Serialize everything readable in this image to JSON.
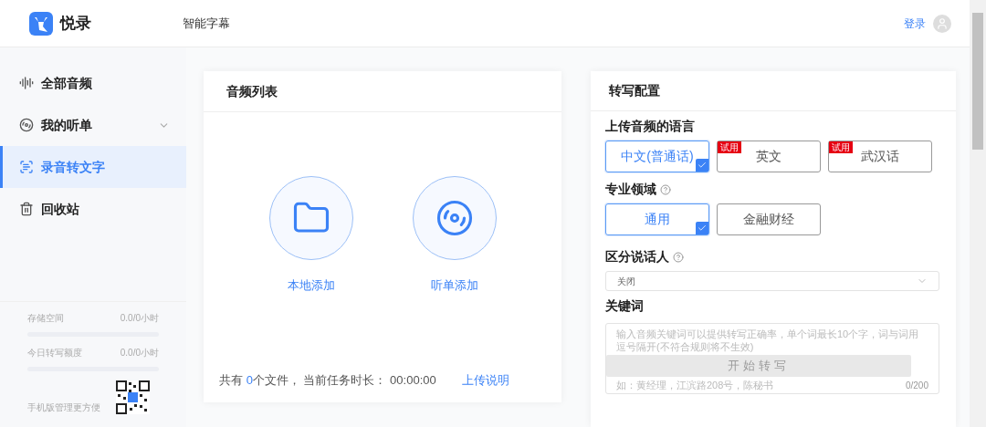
{
  "header": {
    "brand": "悦录",
    "nav_link": "智能字幕",
    "login": "登录"
  },
  "sidebar": {
    "items": [
      {
        "label": "全部音频",
        "selected": false
      },
      {
        "label": "我的听单",
        "selected": false,
        "expanded": false
      },
      {
        "label": "录音转文字",
        "selected": true
      },
      {
        "label": "回收站",
        "selected": false
      }
    ],
    "quotas": [
      {
        "label": "存储空间",
        "reading": "0.0/0小时",
        "level": 0
      },
      {
        "label": "今日转写额度",
        "reading": "0.0/0小时",
        "level": 0
      }
    ],
    "mobile_hint": "手机版管理更方便"
  },
  "audio_list": {
    "title": "音频列表",
    "actions": [
      {
        "label": "本地添加"
      },
      {
        "label": "听单添加"
      }
    ],
    "summary_prefix": "共有",
    "file_count": "0",
    "summary_middle": "个文件， 当前任务时长：",
    "duration": "00:00:00",
    "help_link": "上传说明"
  },
  "config": {
    "title": "转写配置",
    "language": {
      "label": "上传音频的语言",
      "options": [
        {
          "label": "中文(普通话)",
          "selected": true
        },
        {
          "label": "英文",
          "selected": false,
          "badge": "试用"
        },
        {
          "label": "武汉话",
          "selected": false,
          "badge": "试用"
        }
      ]
    },
    "domain": {
      "label": "专业领域",
      "options": [
        {
          "label": "通用",
          "selected": true
        },
        {
          "label": "金融财经",
          "selected": false
        }
      ]
    },
    "speaker": {
      "label": "区分说话人",
      "value": "关闭"
    },
    "keywords": {
      "label": "关键词",
      "placeholder": "输入音频关键词可以提供转写正确率，单个词最长10个字，词与词用逗号隔开(不符合规则将不生效)",
      "example": "如：黄经理，江滨路208号，陈秘书",
      "counter": "0/200"
    },
    "start_button": {
      "label": "开始转写",
      "disabled": true
    }
  }
}
